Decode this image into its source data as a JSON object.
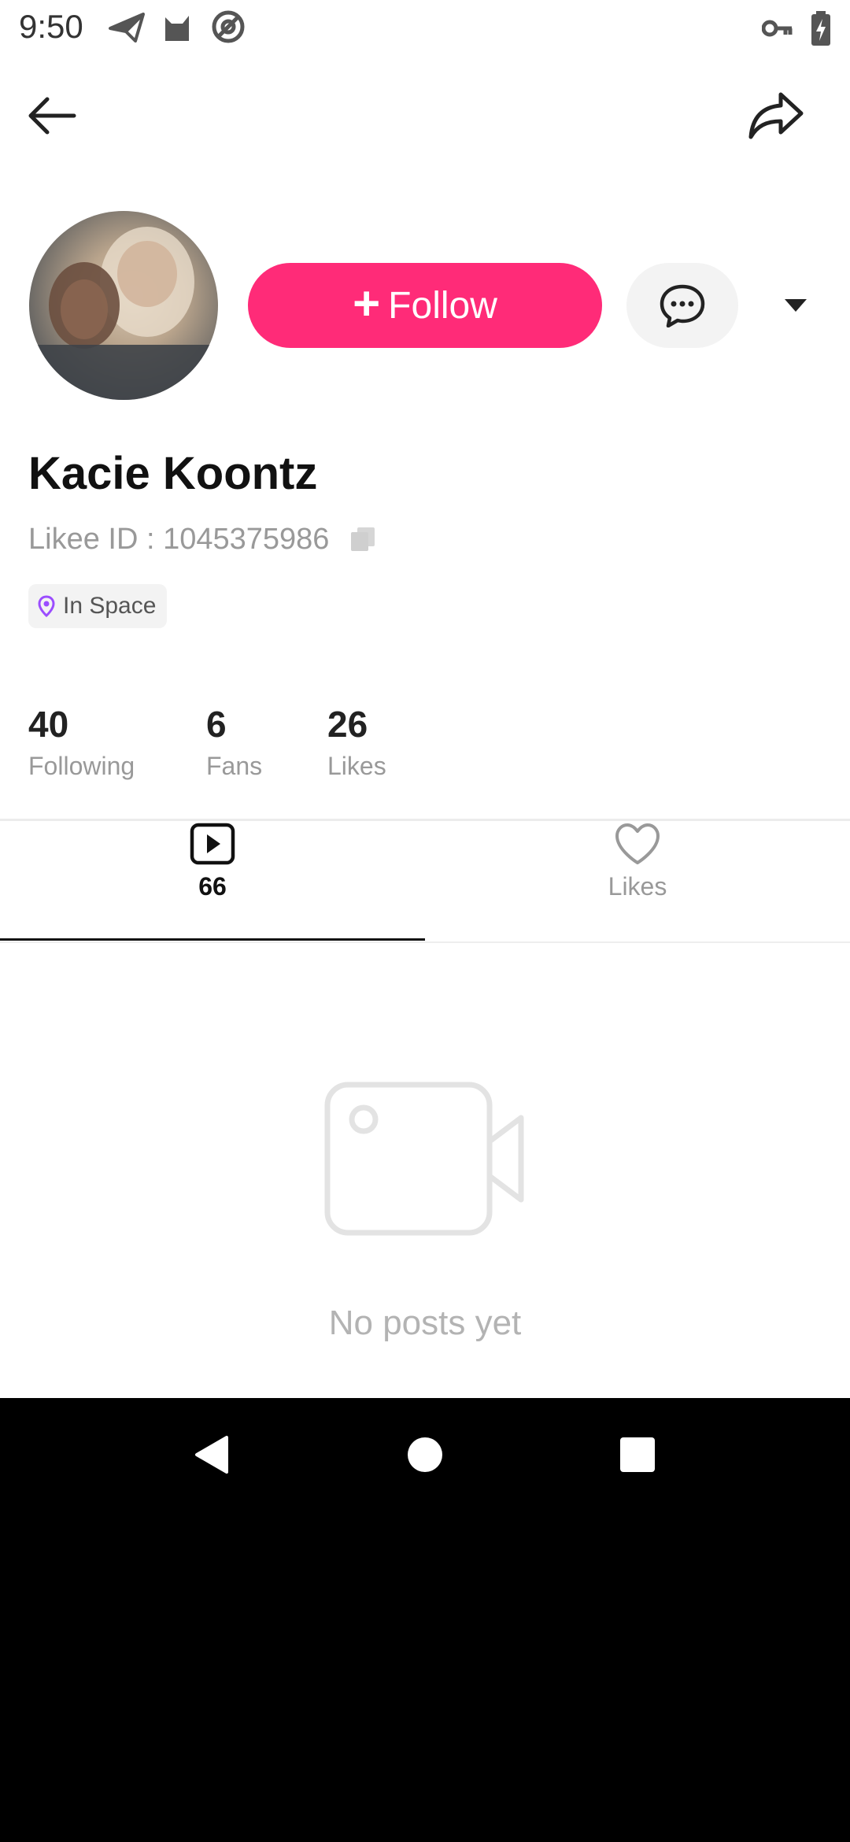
{
  "status_bar": {
    "time": "9:50",
    "left_icons": [
      "send-icon",
      "cat-icon",
      "at-sign-icon"
    ],
    "right_icons": [
      "key-icon",
      "battery-charging-icon"
    ]
  },
  "top_bar": {
    "back_icon": "arrow-left-icon",
    "share_icon": "share-icon"
  },
  "profile": {
    "name": "Kacie Koontz",
    "likee_id": "Likee ID : 1045375986",
    "location": "In Space",
    "follow_label": "Follow",
    "accent_color": "#ff2b78"
  },
  "stats": [
    {
      "value": "40",
      "label": "Following"
    },
    {
      "value": "6",
      "label": "Fans"
    },
    {
      "value": "26",
      "label": "Likes"
    }
  ],
  "tabs": [
    {
      "icon": "video-play-icon",
      "label": "66",
      "selected": true
    },
    {
      "icon": "heart-icon",
      "label": "Likes",
      "selected": false
    }
  ],
  "empty_state": {
    "icon": "video-camera-icon",
    "text": "No posts yet"
  },
  "nav_bar": [
    "back-triangle-icon",
    "home-circle-icon",
    "recents-square-icon"
  ]
}
